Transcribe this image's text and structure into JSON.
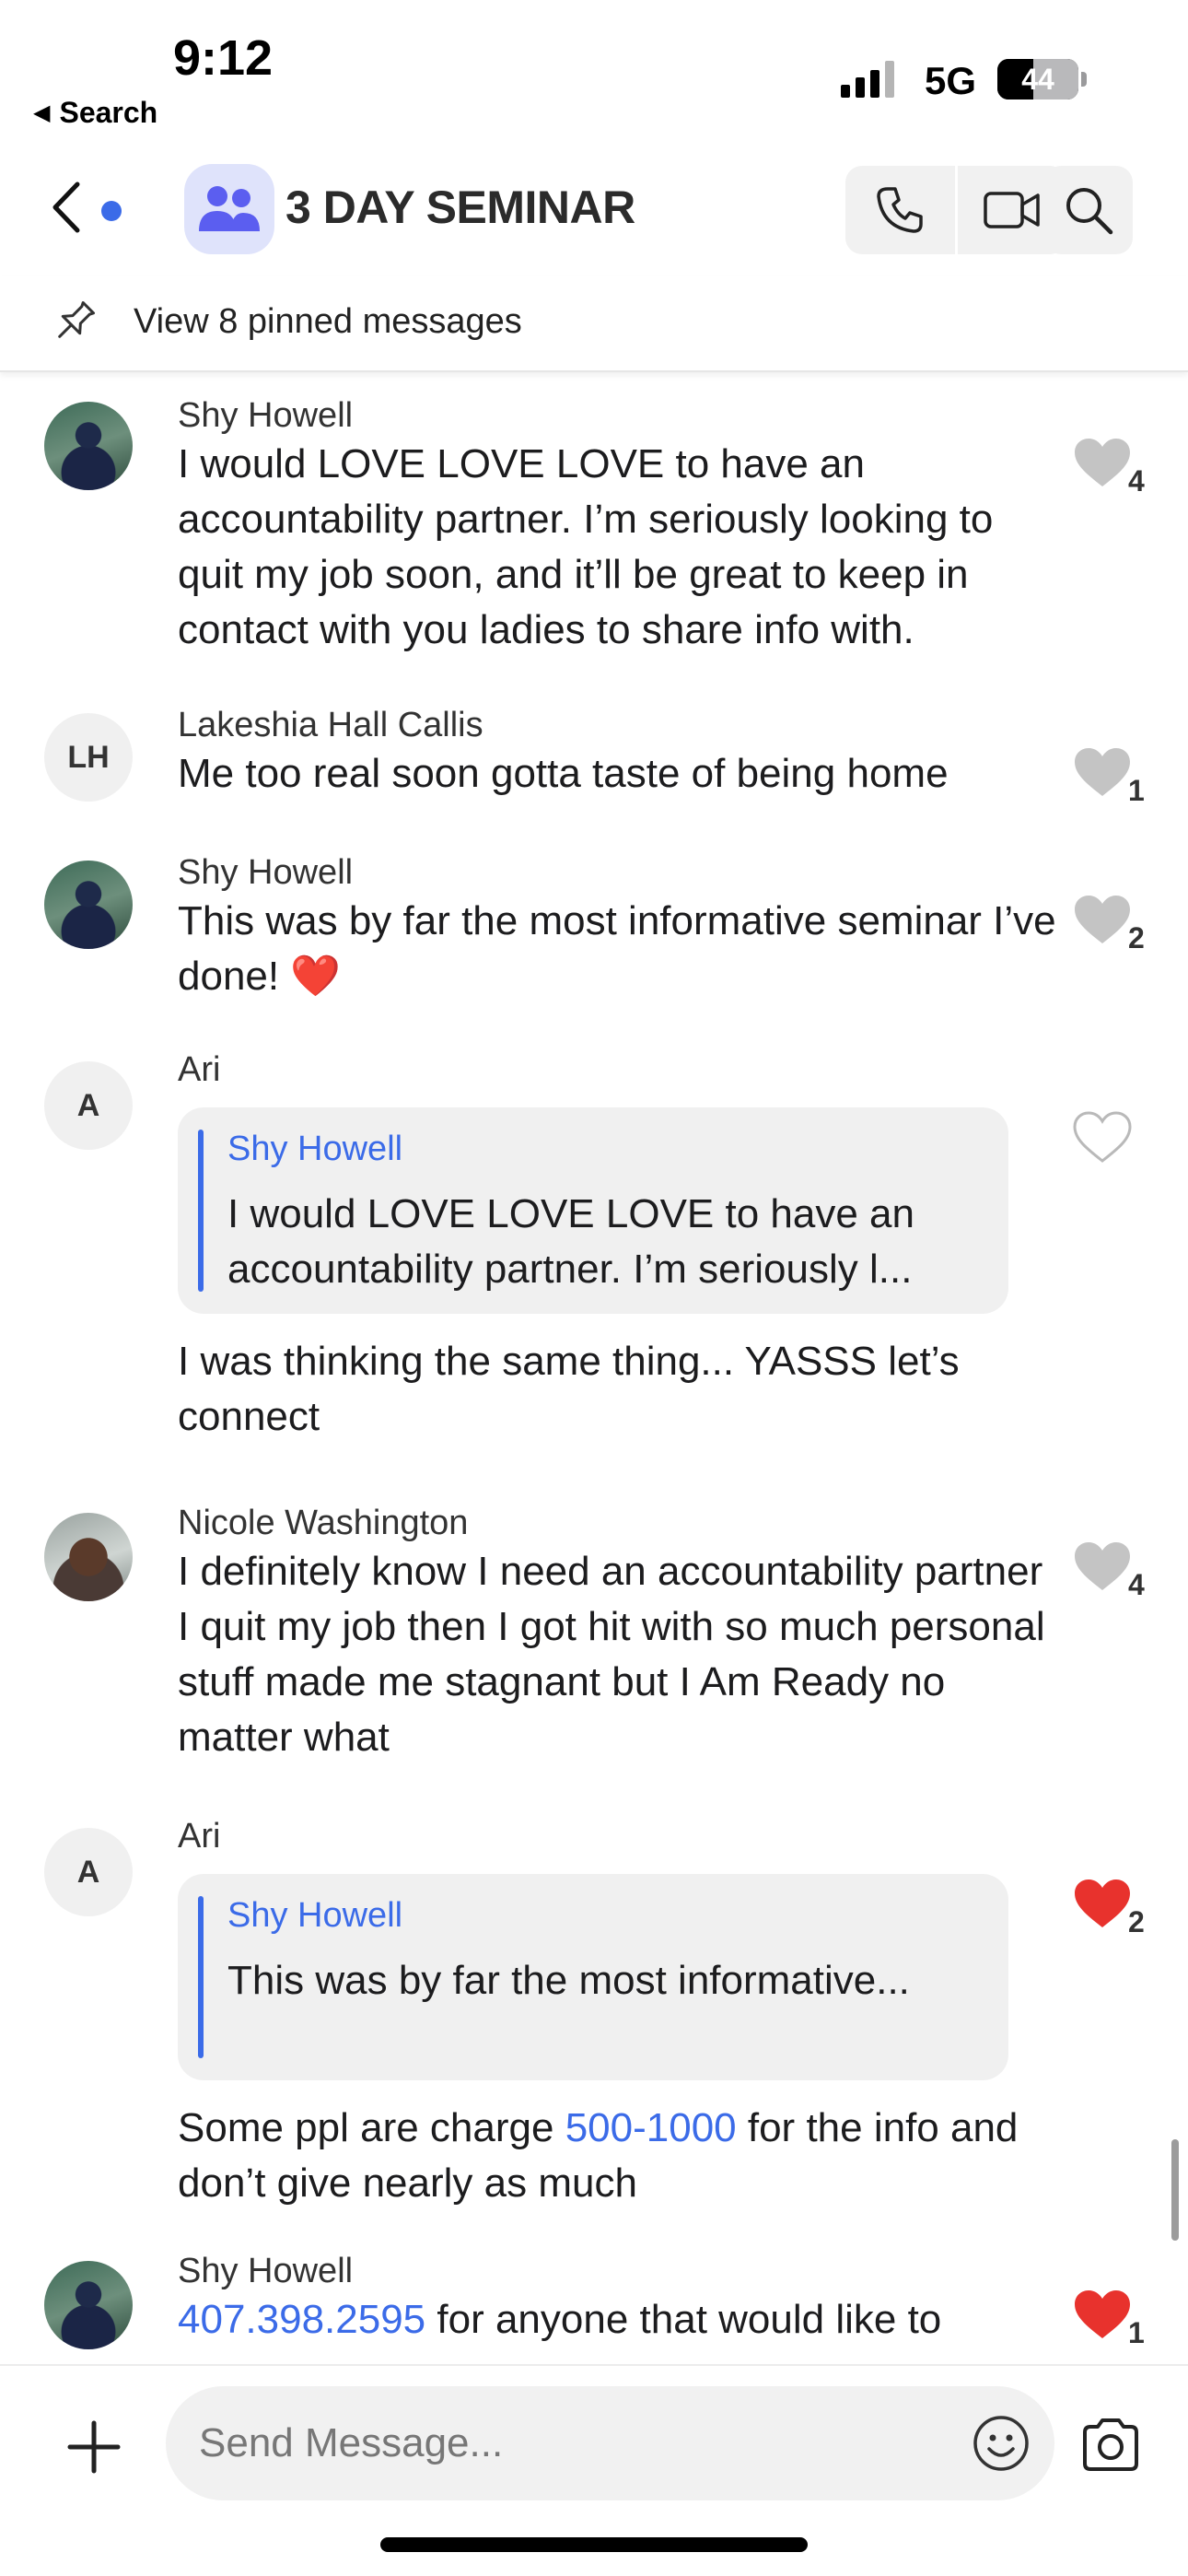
{
  "status_bar": {
    "time": "9:12",
    "back_app": "Search",
    "network": "5G",
    "battery": "44",
    "battery_level": 0.44
  },
  "header": {
    "title": "3 DAY SEMINAR",
    "icons": [
      "back-chevron-icon",
      "group-icon",
      "phone-icon",
      "video-icon",
      "search-icon"
    ],
    "accent_color": "#3b6be8"
  },
  "pinned": {
    "label": "View 8 pinned messages"
  },
  "messages": [
    {
      "sender": "Shy Howell",
      "text": "I would LOVE LOVE LOVE to have an accountability partner. I’m seriously looking to quit my job soon, and it’ll be great to keep in contact with you ladies to share info with.",
      "likes": "4",
      "liked": false
    },
    {
      "sender": "Lakeshia Hall Callis",
      "initials": "LH",
      "text": "Me too real soon gotta taste of being home",
      "likes": "1",
      "liked": false
    },
    {
      "sender": "Shy Howell",
      "text": "This was by far the most informative seminar I’ve done!",
      "emoji": "❤️",
      "likes": "2",
      "liked": false
    },
    {
      "sender": "Ari",
      "initials": "A",
      "quote_name": "Shy Howell",
      "quote_text": "I would LOVE LOVE LOVE to have an accountability partner. I’m seriously l...",
      "text": "I was thinking the same thing... YASSS let’s connect",
      "likes": "",
      "liked": false
    },
    {
      "sender": "Nicole Washington",
      "text": "I definitely know I need an accountability partner I quit my job then I got hit with so much personal stuff made me stagnant but I Am Ready no matter what",
      "likes": "4",
      "liked": false
    },
    {
      "sender": "Ari",
      "initials": "A",
      "quote_name": "Shy Howell",
      "quote_text": "This was by far the most informative...",
      "text_before": "Some ppl are charge ",
      "text_link": "500-1000",
      "text_after": " for the info and don’t give nearly as much",
      "likes": "2",
      "liked": true
    },
    {
      "sender": "Shy Howell",
      "text_link": "407.398.2595",
      "text_after": " for anyone that would like to",
      "likes": "1",
      "liked": true
    }
  ],
  "composer": {
    "placeholder": "Send Message..."
  },
  "colors": {
    "heart_liked": "#e8322d",
    "heart_unliked": "#c4c4c4",
    "link": "#3b6be8"
  }
}
